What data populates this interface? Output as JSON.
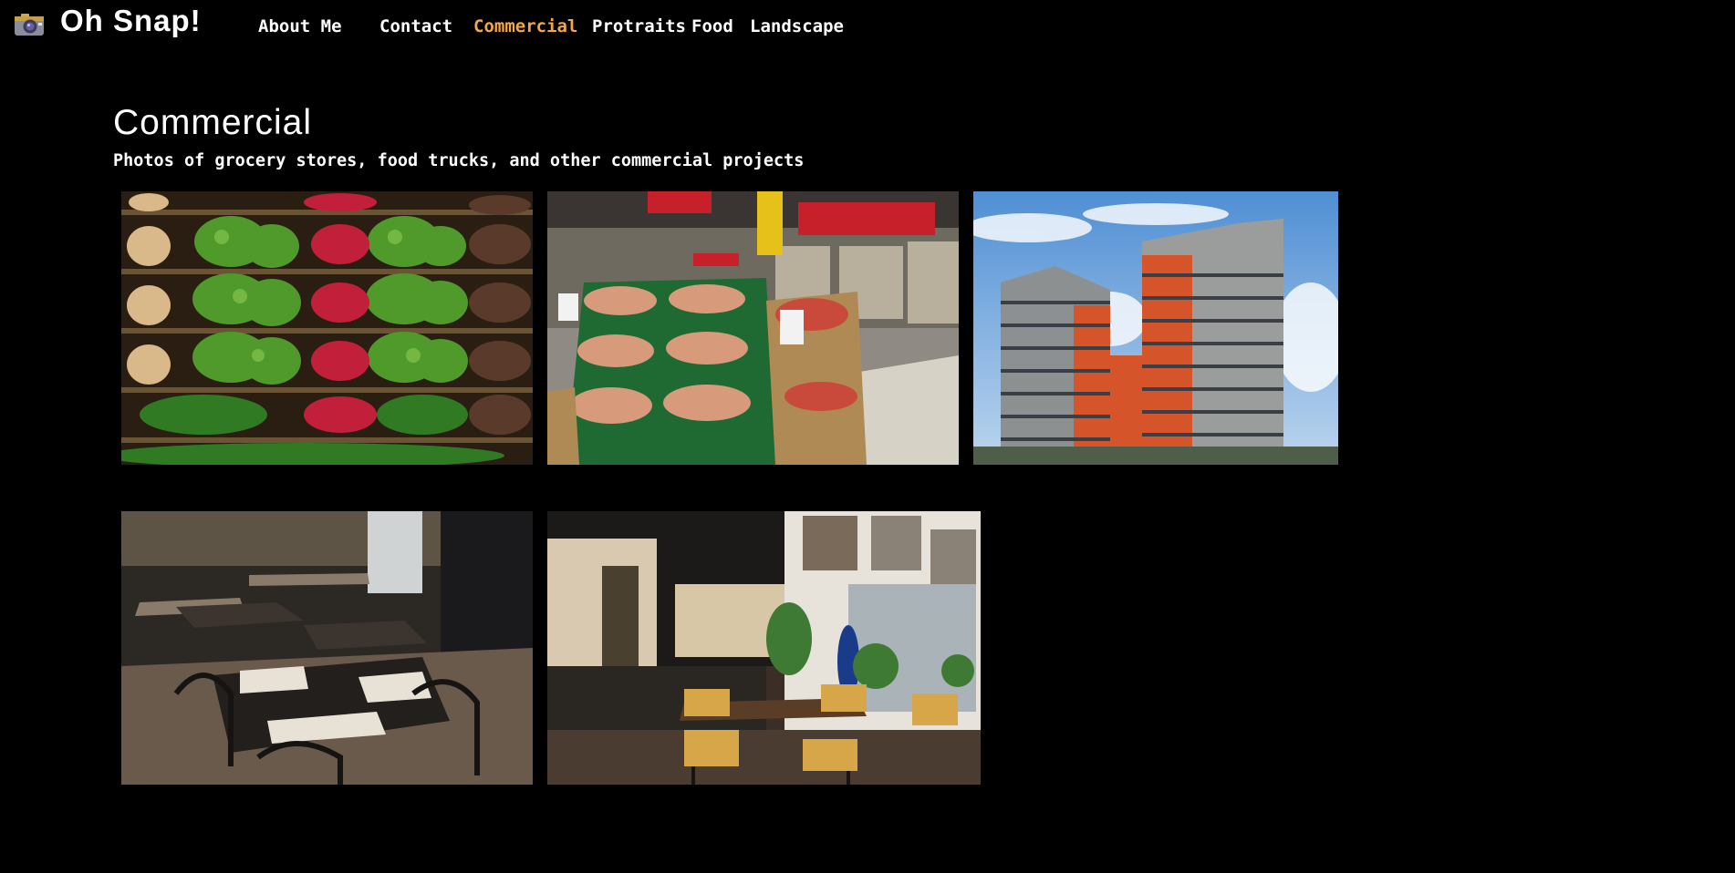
{
  "brand": {
    "name": "Oh Snap!",
    "icon": "camera-icon"
  },
  "nav": [
    {
      "label": "About Me",
      "active": false
    },
    {
      "label": "Contact",
      "active": false
    },
    {
      "label": "Commercial",
      "active": true
    },
    {
      "label": "Protraits",
      "active": false
    },
    {
      "label": "Food",
      "active": false
    },
    {
      "label": "Landscape",
      "active": false
    }
  ],
  "colors": {
    "background": "#000000",
    "text": "#ffffff",
    "active_nav": "#f2a74b"
  },
  "page": {
    "title": "Commercial",
    "subtitle": "Photos of grocery stores, food trucks, and other commercial projects"
  },
  "gallery": [
    {
      "subject": "grocery-vegetable-shelves"
    },
    {
      "subject": "supermarket-produce-aisle"
    },
    {
      "subject": "apartment-tower"
    },
    {
      "subject": "restaurant-dining-room"
    },
    {
      "subject": "cafe-interior"
    }
  ]
}
